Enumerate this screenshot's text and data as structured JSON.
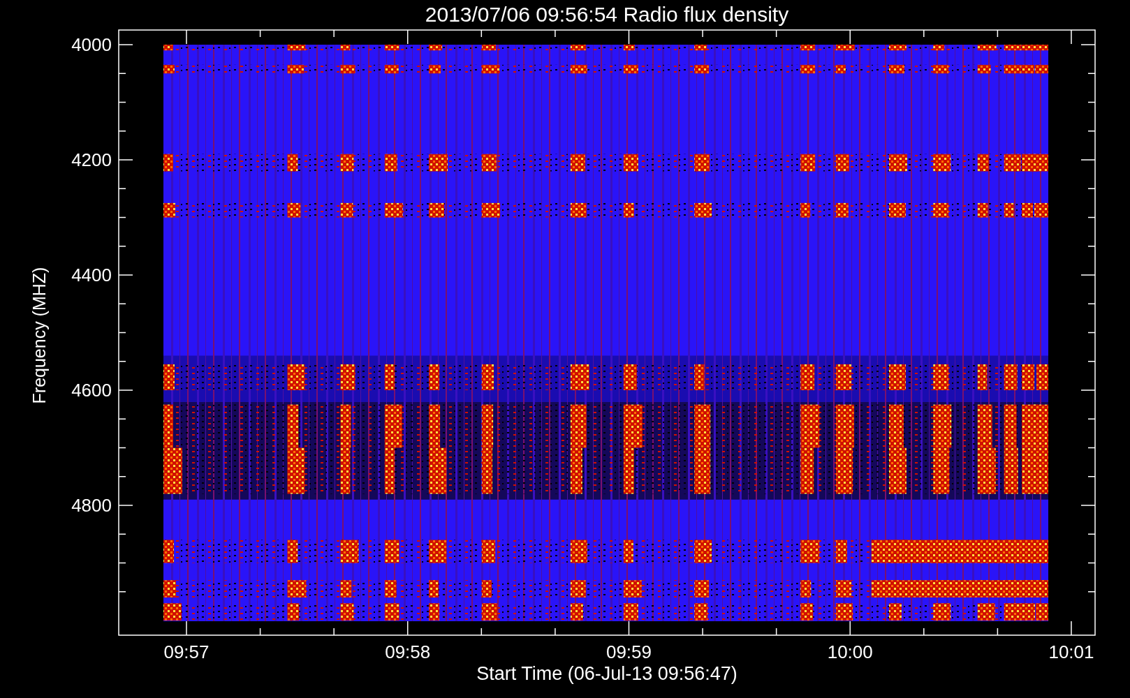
{
  "title": "2013/07/06 09:56:54 Radio flux density",
  "y_axis": {
    "label": "Frequency (MHZ)",
    "ticks": [
      "4000",
      "4200",
      "4400",
      "4600",
      "4800"
    ]
  },
  "x_axis": {
    "label": "Start Time (06-Jul-13 09:56:47)",
    "ticks": [
      "09:57",
      "09:58",
      "09:59",
      "10:00",
      "10:01"
    ]
  }
}
